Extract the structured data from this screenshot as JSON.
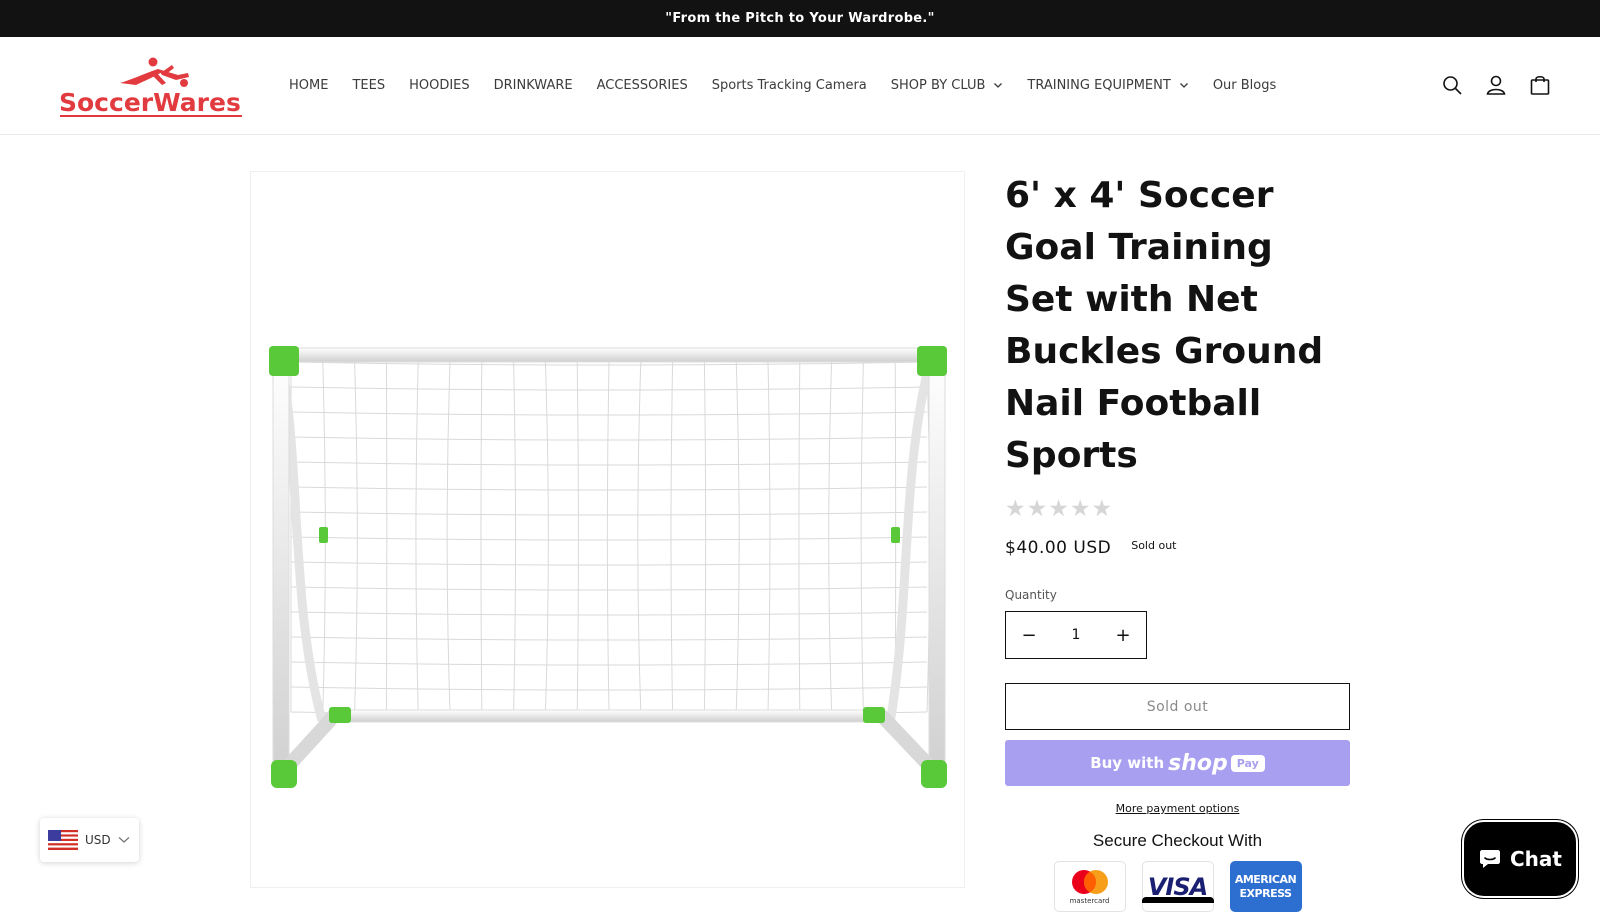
{
  "announcement": "\"From the Pitch to Your Wardrobe.\"",
  "brand": {
    "name": "SoccerWares",
    "color": "#e23b3f"
  },
  "nav": {
    "items": [
      {
        "label": "HOME",
        "dropdown": false
      },
      {
        "label": "TEES",
        "dropdown": false
      },
      {
        "label": "HOODIES",
        "dropdown": false
      },
      {
        "label": "DRINKWARE",
        "dropdown": false
      },
      {
        "label": "ACCESSORIES",
        "dropdown": false
      },
      {
        "label": "Sports Tracking Camera",
        "dropdown": false
      },
      {
        "label": "SHOP BY CLUB",
        "dropdown": true
      },
      {
        "label": "TRAINING EQUIPMENT",
        "dropdown": true
      },
      {
        "label": "Our Blogs",
        "dropdown": false
      }
    ]
  },
  "header_icons": [
    "search-icon",
    "account-icon",
    "cart-icon"
  ],
  "product": {
    "title": "6' x 4' Soccer Goal Training Set with Net Buckles Ground Nail Football Sports",
    "rating_stars": "★★★★★",
    "rating_value": 0,
    "price": "$40.00 USD",
    "badge": "Sold out",
    "quantity_label": "Quantity",
    "quantity": "1",
    "decrease_symbol": "−",
    "increase_symbol": "+",
    "sold_out_button": "Sold out",
    "buy_with": "Buy with",
    "shop_logo": "shop",
    "pay_logo": "Pay",
    "more_payment": "More payment options",
    "secure_heading": "Secure Checkout With",
    "cards": {
      "mastercard_label": "mastercard",
      "visa_label": "VISA",
      "amex_label_1": "AMERICAN",
      "amex_label_2": "EXPRESS"
    }
  },
  "currency": {
    "code": "USD"
  },
  "chat": {
    "label": "Chat"
  },
  "colors": {
    "accent_purple": "#a99ff0",
    "goal_green": "#59c93a",
    "announce_bg": "#121212"
  }
}
